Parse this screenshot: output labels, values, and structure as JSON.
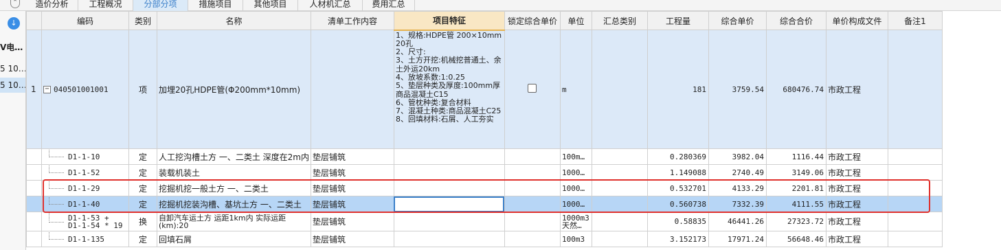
{
  "tabs": [
    "造价分析",
    "工程概况",
    "分部分项",
    "措施项目",
    "其他项目",
    "人材机汇总",
    "费用汇总"
  ],
  "active_tab": "分部分项",
  "side_panel": {
    "download_icon": "download-icon",
    "items": [
      "V电…",
      "5 10…",
      "5 10…"
    ]
  },
  "columns": [
    "编码",
    "类别",
    "名称",
    "清单工作内容",
    "项目特征",
    "锁定综合单价",
    "单位",
    "汇总类别",
    "工程量",
    "综合单价",
    "综合合价",
    "单价构成文件",
    "备注1"
  ],
  "highlight_column": "项目特征",
  "main_row": {
    "index": "1",
    "code": "040501001001",
    "category": "项",
    "name": "加埋20孔HDPE管(Φ200mm*10mm)",
    "features": "1、规格:HDPE管 200×10mm 20孔\n2、尺寸:\n3、土方开挖:机械挖普通土、余土外运20km\n4、放坡系数:1:0.25\n5、垫层种类及厚度:100mm厚商品混凝土C15\n6、管枕种类:复合材料\n7、混凝土种类:商品混凝土C25\n8、回填材料:石屑、人工夯实",
    "unit": "m",
    "quantity": "181",
    "unit_price": "3759.54",
    "total_price": "680476.74",
    "price_file": "市政工程"
  },
  "rows": [
    {
      "code": "D1-1-10",
      "category": "定",
      "name": "人工挖沟槽土方 一、二类土 深度在2m内",
      "work": "垫层铺筑",
      "unit": "100m…",
      "quantity": "0.280369",
      "unit_price": "3982.04",
      "total_price": "1116.44",
      "price_file": "市政工程"
    },
    {
      "code": "D1-1-52",
      "category": "定",
      "name": "装载机装土",
      "work": "垫层铺筑",
      "unit": "1000…",
      "quantity": "1.149088",
      "unit_price": "2740.49",
      "total_price": "3149.06",
      "price_file": "市政工程"
    },
    {
      "code": "D1-1-29",
      "category": "定",
      "name": "挖掘机挖一般土方 一、二类土",
      "work": "垫层铺筑",
      "unit": "1000…",
      "quantity": "0.532701",
      "unit_price": "4133.29",
      "total_price": "2201.81",
      "price_file": "市政工程"
    },
    {
      "code": "D1-1-40",
      "category": "定",
      "name": "挖掘机挖装沟槽、基坑土方 一、二类土",
      "work": "垫层铺筑",
      "unit": "1000…",
      "quantity": "0.560738",
      "unit_price": "7332.39",
      "total_price": "4111.55",
      "price_file": "市政工程"
    },
    {
      "code": "D1-1-53 + D1-1-54 * 19",
      "category": "换",
      "name": "自卸汽车运土方 运距1km内  实际运距(km):20",
      "work": "垫层铺筑",
      "unit": "1000m3 天然…",
      "quantity": "0.58835",
      "unit_price": "46441.26",
      "total_price": "27323.72",
      "price_file": "市政工程"
    },
    {
      "code": "D1-1-135",
      "category": "定",
      "name": "回填石屑",
      "work": "垫层铺筑",
      "unit": "100m3",
      "quantity": "3.152173",
      "unit_price": "17971.24",
      "total_price": "56648.46",
      "price_file": "市政工程"
    }
  ]
}
